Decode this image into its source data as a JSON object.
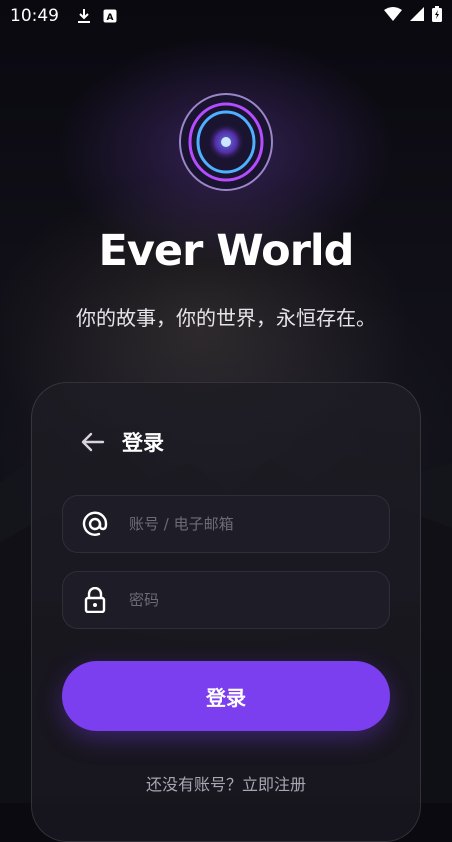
{
  "status_bar": {
    "time": "10:49",
    "icons": [
      "download-icon",
      "app-notification-icon",
      "wifi-icon",
      "signal-icon",
      "battery-icon"
    ]
  },
  "app": {
    "title": "Ever World",
    "tagline": "你的故事，你的世界，永恒存在。"
  },
  "login_card": {
    "title": "登录",
    "account_placeholder": "账号 / 电子邮箱",
    "password_placeholder": "密码",
    "submit_label": "登录",
    "register_link": "还没有账号？立即注册"
  },
  "colors": {
    "accent": "#7b3ff0",
    "background": "#0b0a10",
    "card": "#1e1c26"
  }
}
